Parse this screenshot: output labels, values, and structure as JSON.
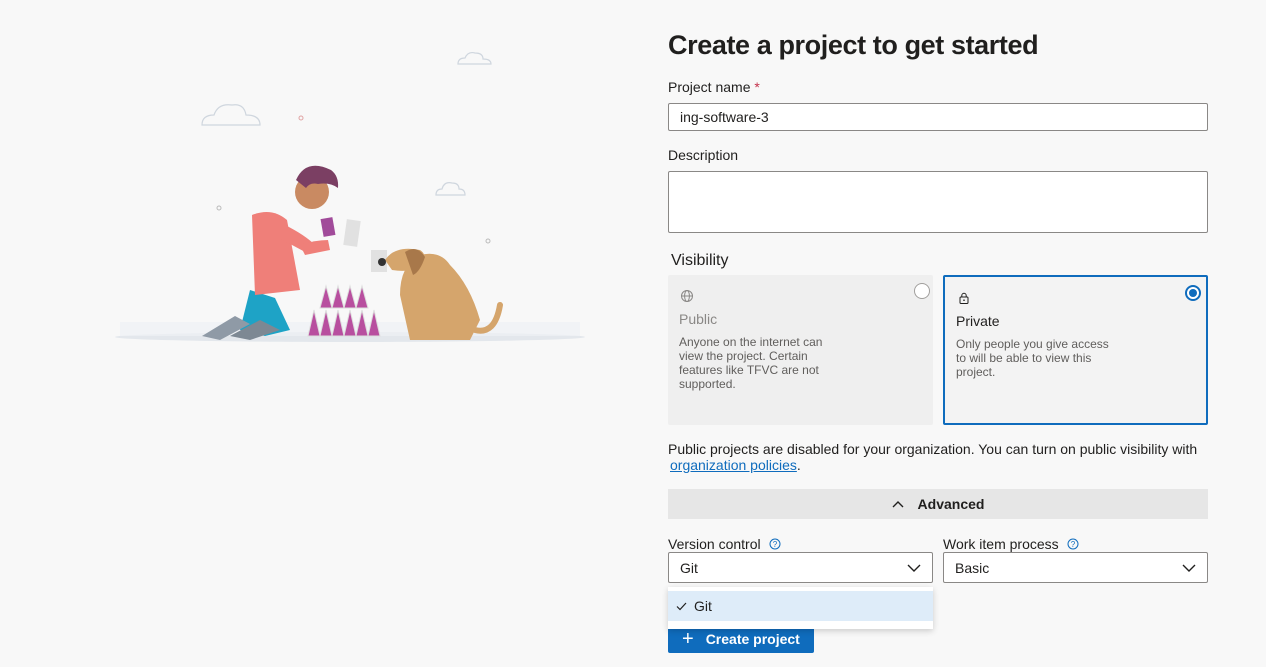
{
  "form": {
    "title": "Create a project to get started",
    "project_name": {
      "label": "Project name",
      "required_marker": "*",
      "value": "ing-software-3"
    },
    "description": {
      "label": "Description",
      "value": ""
    },
    "visibility": {
      "heading": "Visibility",
      "selected": "Private",
      "options": [
        {
          "name": "Public",
          "icon": "globe-icon",
          "description": "Anyone on the internet can view the project. Certain features like TFVC are not supported.",
          "disabled": true
        },
        {
          "name": "Private",
          "icon": "lock-icon",
          "description": "Only people you give access to will be able to view this project.",
          "disabled": false
        }
      ]
    },
    "notice": {
      "text": "Public projects are disabled for your organization. You can turn on public visibility with",
      "link": "organization policies",
      "end": "."
    },
    "advanced": {
      "label": "Advanced",
      "expanded": true
    },
    "version_control": {
      "label": "Version control",
      "value": "Git",
      "options": [
        "Git"
      ]
    },
    "work_item_process": {
      "label": "Work item process",
      "value": "Basic"
    },
    "create_button": {
      "label": "Create project"
    }
  },
  "colors": {
    "accent": "#0f6cbd",
    "required": "#c4314b",
    "background": "#f8f8f8"
  }
}
